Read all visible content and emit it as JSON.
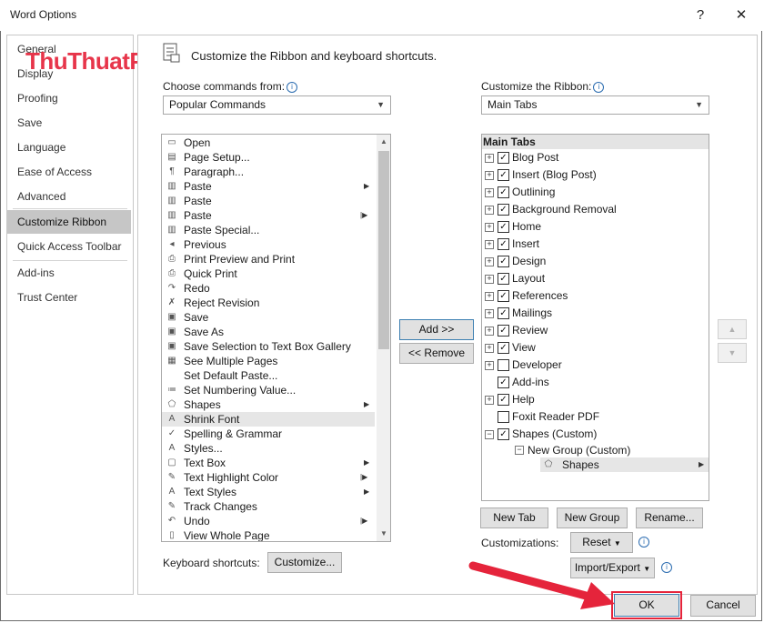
{
  "window": {
    "title": "Word Options",
    "help_glyph": "?",
    "close_glyph": "✕"
  },
  "watermark": "ThuThuatPhanMem.vn",
  "nav": {
    "items": [
      {
        "label": "General"
      },
      {
        "label": "Display"
      },
      {
        "label": "Proofing"
      },
      {
        "label": "Save"
      },
      {
        "label": "Language"
      },
      {
        "label": "Ease of Access"
      },
      {
        "label": "Advanced"
      },
      {
        "label": "Customize Ribbon",
        "selected": true
      },
      {
        "label": "Quick Access Toolbar"
      },
      {
        "label": "Add-ins"
      },
      {
        "label": "Trust Center"
      }
    ]
  },
  "header": {
    "text": "Customize the Ribbon and keyboard shortcuts."
  },
  "commands": {
    "label": "Choose commands from:",
    "selected": "Popular Commands",
    "items": [
      {
        "label": "Open",
        "icon": "folder-icon"
      },
      {
        "label": "Page Setup...",
        "icon": "page-setup-icon"
      },
      {
        "label": "Paragraph...",
        "icon": "paragraph-icon"
      },
      {
        "label": "Paste",
        "icon": "paste-icon",
        "submenu": "arrow"
      },
      {
        "label": "Paste",
        "icon": "paste-icon"
      },
      {
        "label": "Paste",
        "icon": "paste-icon",
        "submenu": "bar"
      },
      {
        "label": "Paste Special...",
        "icon": "paste-special-icon"
      },
      {
        "label": "Previous",
        "icon": "previous-icon"
      },
      {
        "label": "Print Preview and Print",
        "icon": "print-preview-icon"
      },
      {
        "label": "Quick Print",
        "icon": "quick-print-icon"
      },
      {
        "label": "Redo",
        "icon": "redo-icon"
      },
      {
        "label": "Reject Revision",
        "icon": "reject-revision-icon"
      },
      {
        "label": "Save",
        "icon": "save-icon"
      },
      {
        "label": "Save As",
        "icon": "save-as-icon"
      },
      {
        "label": "Save Selection to Text Box Gallery",
        "icon": "save-selection-icon"
      },
      {
        "label": "See Multiple Pages",
        "icon": "multiple-pages-icon"
      },
      {
        "label": "Set Default Paste...",
        "icon": "blank-icon"
      },
      {
        "label": "Set Numbering Value...",
        "icon": "numbering-icon"
      },
      {
        "label": "Shapes",
        "icon": "shapes-icon",
        "submenu": "arrow"
      },
      {
        "label": "Shrink Font",
        "icon": "shrink-font-icon",
        "selected": true
      },
      {
        "label": "Spelling & Grammar",
        "icon": "spelling-icon"
      },
      {
        "label": "Styles...",
        "icon": "styles-icon"
      },
      {
        "label": "Text Box",
        "icon": "text-box-icon",
        "submenu": "arrow"
      },
      {
        "label": "Text Highlight Color",
        "icon": "highlight-icon",
        "submenu": "bar"
      },
      {
        "label": "Text Styles",
        "icon": "text-styles-icon",
        "submenu": "arrow"
      },
      {
        "label": "Track Changes",
        "icon": "track-changes-icon"
      },
      {
        "label": "Undo",
        "icon": "undo-icon",
        "submenu": "bar"
      },
      {
        "label": "View Whole Page",
        "icon": "whole-page-icon"
      }
    ]
  },
  "ribbon": {
    "label": "Customize the Ribbon:",
    "selected": "Main Tabs",
    "tree_header": "Main Tabs",
    "items": [
      {
        "label": "Blog Post",
        "expander": "+",
        "checked": true
      },
      {
        "label": "Insert (Blog Post)",
        "expander": "+",
        "checked": true
      },
      {
        "label": "Outlining",
        "expander": "+",
        "checked": true
      },
      {
        "label": "Background Removal",
        "expander": "+",
        "checked": true
      },
      {
        "label": "Home",
        "expander": "+",
        "checked": true
      },
      {
        "label": "Insert",
        "expander": "+",
        "checked": true
      },
      {
        "label": "Design",
        "expander": "+",
        "checked": true
      },
      {
        "label": "Layout",
        "expander": "+",
        "checked": true
      },
      {
        "label": "References",
        "expander": "+",
        "checked": true
      },
      {
        "label": "Mailings",
        "expander": "+",
        "checked": true
      },
      {
        "label": "Review",
        "expander": "+",
        "checked": true
      },
      {
        "label": "View",
        "expander": "+",
        "checked": true
      },
      {
        "label": "Developer",
        "expander": "+",
        "checked": false
      },
      {
        "label": "Add-ins",
        "expander": "",
        "checked": true
      },
      {
        "label": "Help",
        "expander": "+",
        "checked": true
      },
      {
        "label": "Foxit Reader PDF",
        "expander": "",
        "checked": false
      },
      {
        "label": "Shapes (Custom)",
        "expander": "−",
        "checked": true
      }
    ],
    "group": "New Group (Custom)",
    "command": "Shapes"
  },
  "buttons": {
    "add": "Add >>",
    "remove": "<< Remove",
    "new_tab": "New Tab",
    "new_group": "New Group",
    "rename": "Rename...",
    "customizations_label": "Customizations:",
    "reset": "Reset",
    "import_export": "Import/Export",
    "keyboard_label": "Keyboard shortcuts:",
    "customize": "Customize...",
    "ok": "OK",
    "cancel": "Cancel",
    "move_up_glyph": "▲",
    "move_down_glyph": "▼",
    "dropdown_glyph": "▼",
    "info_glyph": "i"
  },
  "colors": {
    "accent_red": "#e5243b",
    "selected_nav": "#c6c6c6"
  }
}
